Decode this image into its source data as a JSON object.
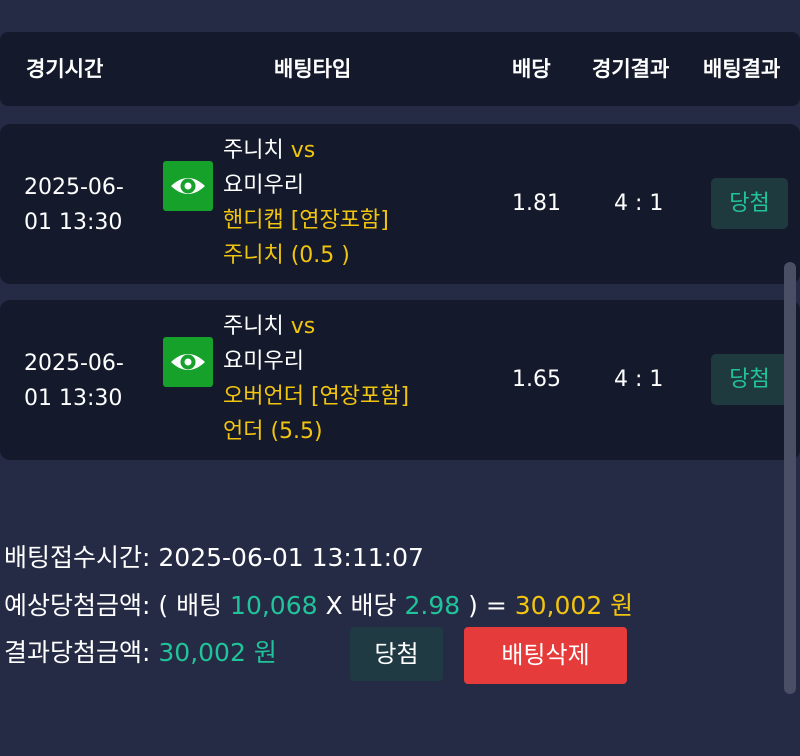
{
  "header": {
    "col_time": "경기시간",
    "col_type": "배팅타입",
    "col_odds": "배당",
    "col_result": "경기결과",
    "col_bet_result": "배팅결과"
  },
  "bets": [
    {
      "time_line1": "2025-06-",
      "time_line2": "01 13:30",
      "icon": "eye-icon",
      "home": "주니치",
      "vs": "vs",
      "away": "요미우리",
      "market": "핸디캡 [연장포함]",
      "pick": "주니치 (0.5 )",
      "odds": "1.81",
      "score": "4 : 1",
      "result": "당첨"
    },
    {
      "time_line1": "2025-06-",
      "time_line2": "01 13:30",
      "icon": "eye-icon",
      "home": "주니치",
      "vs": "vs",
      "away": "요미우리",
      "market": "오버언더 [연장포함]",
      "pick": "언더 (5.5)",
      "odds": "1.65",
      "score": "4 : 1",
      "result": "당첨"
    }
  ],
  "summary": {
    "received_label": "배팅접수시간:",
    "received_value": "2025-06-01 13:11:07",
    "expected_label": "예상당첨금액:",
    "expected_open": "( 배팅",
    "bet_amount": "10,068",
    "x_odds": "X 배당",
    "total_odds": "2.98",
    "expected_close": ") =",
    "expected_amount": "30,002 원",
    "result_label": "결과당첨금액:",
    "result_amount": "30,002 원",
    "win_button": "당첨",
    "delete_button": "배팅삭제"
  },
  "colors": {
    "background": "#262b45",
    "panel": "#141a2c",
    "accent_yellow": "#f1c40f",
    "accent_green": "#20c39a",
    "danger": "#e63b3b",
    "eye_green": "#16a12b"
  }
}
